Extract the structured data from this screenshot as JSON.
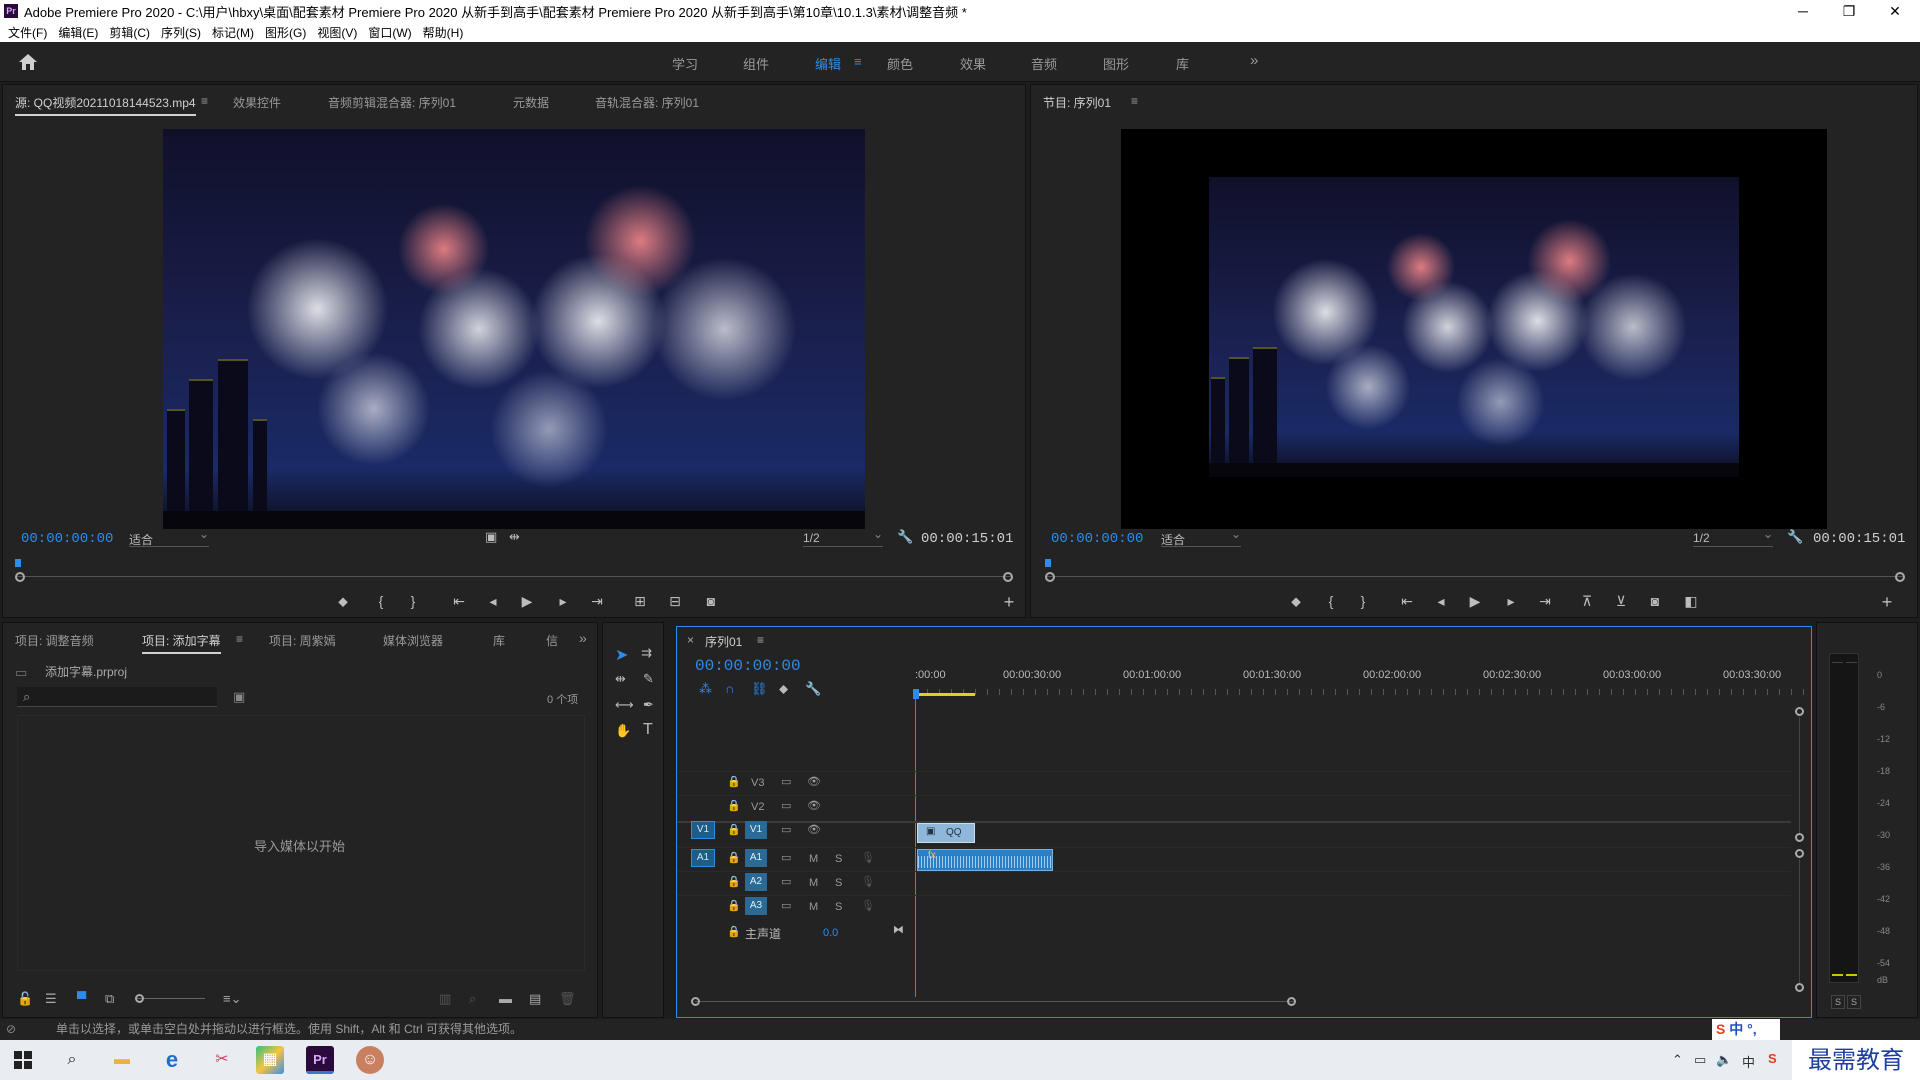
{
  "titlebar": {
    "title": "Adobe Premiere Pro 2020 - C:\\用户\\hbxy\\桌面\\配套素材 Premiere Pro 2020 从新手到高手\\配套素材 Premiere Pro 2020 从新手到高手\\第10章\\10.1.3\\素材\\调整音频 *",
    "app_icon": "Pr"
  },
  "window_controls": {
    "minimize": "─",
    "restore": "❐",
    "close": "✕"
  },
  "menu": [
    "文件(F)",
    "编辑(E)",
    "剪辑(C)",
    "序列(S)",
    "标记(M)",
    "图形(G)",
    "视图(V)",
    "窗口(W)",
    "帮助(H)"
  ],
  "workspace_tabs": [
    "学习",
    "组件",
    "编辑",
    "颜色",
    "效果",
    "音频",
    "图形",
    "库"
  ],
  "workspace_active": "编辑",
  "workspace_more": "»",
  "source_panel": {
    "tabs": [
      "源: QQ视频20211018144523.mp4",
      "效果控件",
      "音频剪辑混合器: 序列01",
      "元数据",
      "音轨混合器: 序列01"
    ],
    "timecode": "00:00:00:00",
    "fit": "适合",
    "resolution": "1/2",
    "duration": "00:00:15:01"
  },
  "program_panel": {
    "tab": "节目: 序列01",
    "timecode": "00:00:00:00",
    "fit": "适合",
    "resolution": "1/2",
    "duration": "00:00:15:01"
  },
  "project_panel": {
    "tabs": [
      "项目: 调整音频",
      "项目: 添加字幕",
      "项目: 周紫嫣",
      "媒体浏览器",
      "库",
      "信"
    ],
    "project_file": "添加字幕.prproj",
    "item_count": "0 个项",
    "empty_message": "导入媒体以开始"
  },
  "timeline": {
    "tab": "序列01",
    "timecode": "00:00:00:00",
    "ruler": [
      ":00:00",
      "00:00:30:00",
      "00:01:00:00",
      "00:01:30:00",
      "00:02:00:00",
      "00:02:30:00",
      "00:03:00:00",
      "00:03:30:00"
    ],
    "video_tracks": [
      "V3",
      "V2",
      "V1"
    ],
    "audio_tracks": [
      "A1",
      "A2",
      "A3"
    ],
    "source_v": "V1",
    "source_a": "A1",
    "mute": "M",
    "solo": "S",
    "master_label": "主声道",
    "master_value": "0.0",
    "clip_label": "QQ"
  },
  "meter": {
    "scale": [
      "0",
      "-6",
      "-12",
      "-18",
      "-24",
      "-30",
      "-36",
      "-42",
      "-48",
      "-54",
      "dB"
    ],
    "solo": [
      "S",
      "S"
    ]
  },
  "status": {
    "text": "单击以选择，或单击空白处并拖动以进行框选。使用 Shift，Alt 和 Ctrl 可获得其他选项。"
  },
  "ime": {
    "label": "中",
    "watermark": "最需教育"
  },
  "colors": {
    "accent": "#2d8ceb",
    "panel_bg": "#232323",
    "clip_video": "#8fb8d8",
    "clip_audio": "#2b7fc4"
  }
}
